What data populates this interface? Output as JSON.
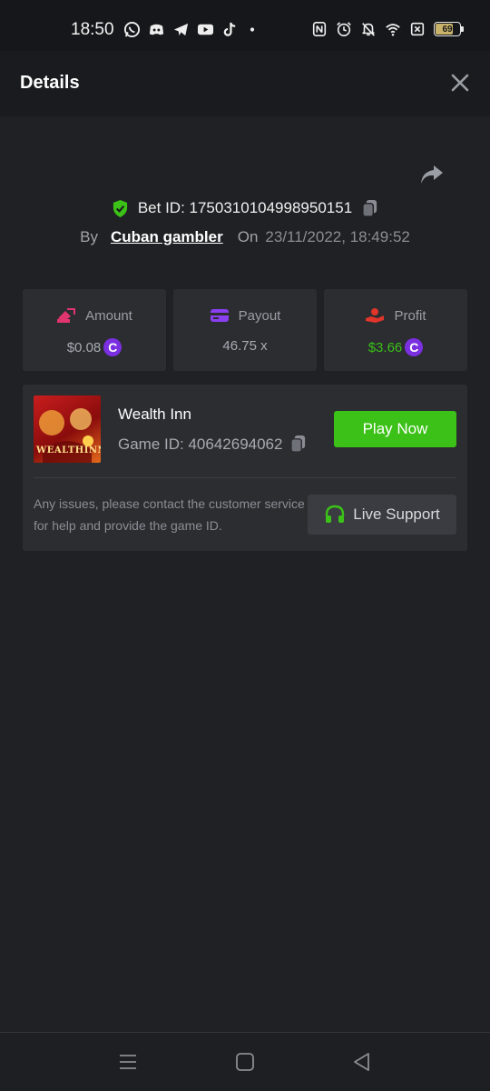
{
  "status_bar": {
    "time": "18:50",
    "app_icons": [
      "whatsapp-icon",
      "discord-icon",
      "telegram-icon",
      "youtube-icon",
      "tiktok-icon",
      "dot-icon"
    ],
    "system_icons": [
      "nfc-icon",
      "alarm-icon",
      "mute-icon",
      "wifi-icon",
      "sim-icon"
    ],
    "battery_level": "69"
  },
  "header": {
    "title": "Details",
    "close_icon": "close-icon"
  },
  "bet": {
    "id_text": "Bet ID: 1750310104998950151",
    "by_label": "By",
    "username": "Cuban gambler",
    "on_label": "On",
    "date": "23/11/2022, 18:49:52"
  },
  "stats": {
    "amount": {
      "label": "Amount",
      "value": "$0.08",
      "coin": "C"
    },
    "payout": {
      "label": "Payout",
      "value": "46.75 x"
    },
    "profit": {
      "label": "Profit",
      "value": "$3.66",
      "coin": "C"
    }
  },
  "game": {
    "name": "Wealth Inn",
    "thumbnail_text": "WEALTHINN",
    "id_text": "Game ID: 40642694062",
    "play_label": "Play Now",
    "notice": "Any issues, please contact the customer service for help and provide the game ID.",
    "support_label": "Live Support"
  },
  "colors": {
    "background": "#202124",
    "card": "#2b2d31",
    "accent_green": "#3bc117",
    "coin_purple": "#7a2fe0"
  }
}
